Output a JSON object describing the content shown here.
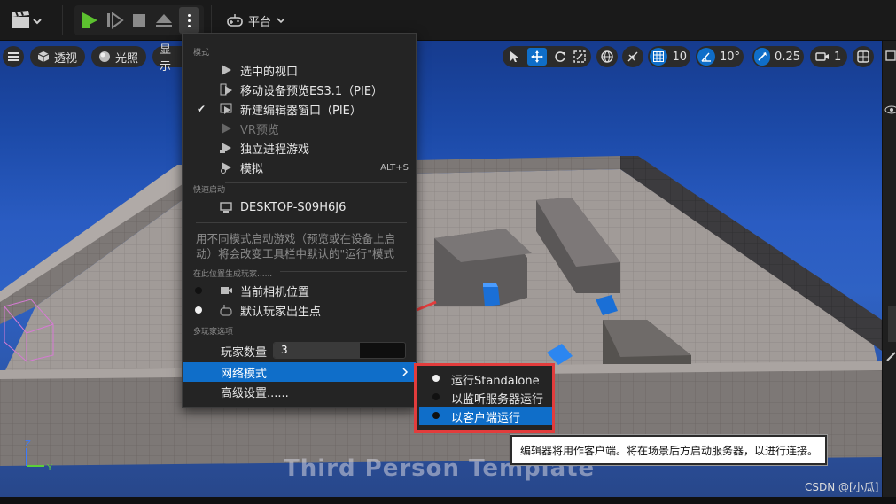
{
  "toolbar": {
    "platform_label": "平台"
  },
  "viewport": {
    "perspective_label": "透视",
    "lit_label": "光照",
    "show_label": "显示",
    "grid_snap": "10",
    "rotation_snap": "10°",
    "scale_snap": "0.25",
    "camera_speed": "1",
    "overlay_text": "Third Person Template"
  },
  "menu": {
    "section_mode": "模式",
    "items": {
      "selected_viewport": "选中的视口",
      "mobile_preview": "移动设备预览ES3.1（PIE）",
      "new_editor_window": "新建编辑器窗口（PIE）",
      "vr_preview": "VR预览",
      "standalone_game": "独立进程游戏",
      "simulate": "模拟",
      "simulate_shortcut": "ALT+S"
    },
    "section_quick_launch": "快速启动",
    "device_name": "DESKTOP-S09H6J6",
    "description": "用不同模式启动游戏（预览或在设备上启动）将会改变工具栏中默认的\"运行\"模式",
    "section_spawn": "在此位置生成玩家......",
    "spawn_current_camera": "当前相机位置",
    "spawn_default_player_start": "默认玩家出生点",
    "section_multiplayer": "多玩家选项",
    "player_count_label": "玩家数量",
    "player_count_value": "3",
    "net_mode_label": "网络模式",
    "advanced_settings_label": "高级设置......"
  },
  "submenu": {
    "items": [
      "运行Standalone",
      "以监听服务器运行",
      "以客户端运行"
    ],
    "selected_index": 2
  },
  "tooltip": {
    "text": "编辑器将用作客户端。将在场景后方启动服务器，以进行连接。"
  },
  "watermark": "CSDN @[小瓜]",
  "colors": {
    "highlight": "#0f6ec9",
    "annotation_red": "#e23c3c",
    "play_green": "#5cc12f"
  }
}
